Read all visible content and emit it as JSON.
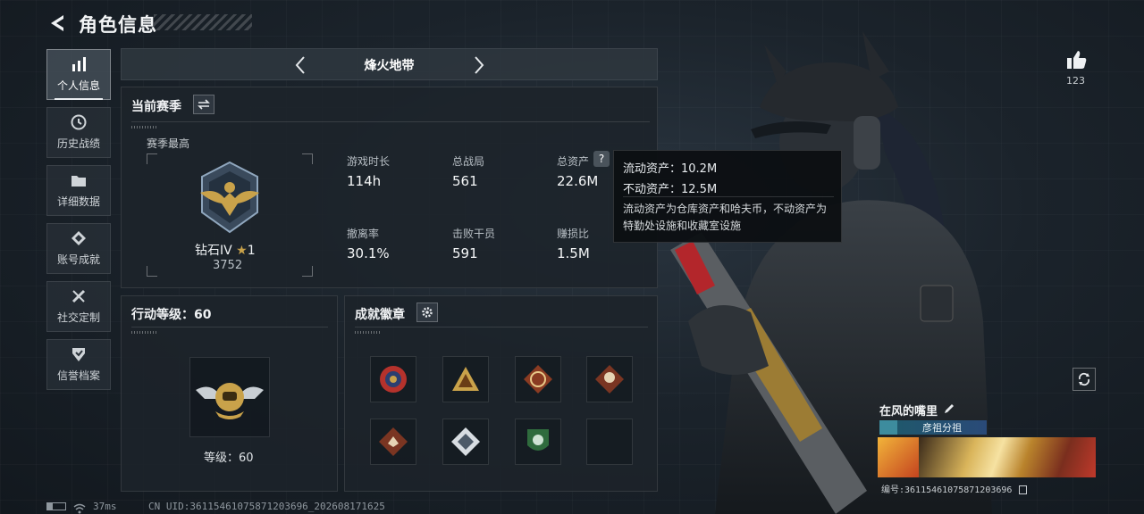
{
  "header": {
    "title": "角色信息"
  },
  "sidebar": {
    "items": [
      {
        "label": "个人信息",
        "icon": "bar-chart-icon",
        "active": true
      },
      {
        "label": "历史战绩",
        "icon": "history-icon"
      },
      {
        "label": "详细数据",
        "icon": "folder-icon"
      },
      {
        "label": "账号成就",
        "icon": "achievement-icon"
      },
      {
        "label": "社交定制",
        "icon": "tools-icon"
      },
      {
        "label": "信誉档案",
        "icon": "credit-icon"
      }
    ]
  },
  "mode": {
    "title": "烽火地带"
  },
  "season": {
    "title": "当前赛季",
    "best_label": "赛季最高",
    "rank_name": "钻石IV",
    "rank_stars": "1",
    "rank_score": "3752",
    "stats": [
      {
        "label": "游戏时长",
        "value": "114h"
      },
      {
        "label": "总战局",
        "value": "561"
      },
      {
        "label": "总资产",
        "value": "22.6M"
      },
      {
        "label": "撤离率",
        "value": "30.1%"
      },
      {
        "label": "击败干员",
        "value": "591"
      },
      {
        "label": "赚损比",
        "value": "1.5M"
      }
    ]
  },
  "tooltip": {
    "line1": "流动资产：10.2M",
    "line2": "不动资产：12.5M",
    "desc": "流动资产为仓库资产和哈夫币，不动资产为特勤处设施和收藏室设施"
  },
  "action_level": {
    "title": "行动等级：60",
    "level_label": "等级：60"
  },
  "achievements": {
    "title": "成就徽章"
  },
  "likes": {
    "count": "123"
  },
  "player": {
    "name": "在风的嘴里",
    "team": "彦祖分祖",
    "uid_label": "编号:36115461075871203696"
  },
  "status_bar": {
    "ping": "37ms",
    "uid": "CN UID:36115461075871203696_202608171625"
  },
  "colors": {
    "accent": "#e8ecef",
    "panel": "#1c232a",
    "gold": "#c9a24a"
  }
}
